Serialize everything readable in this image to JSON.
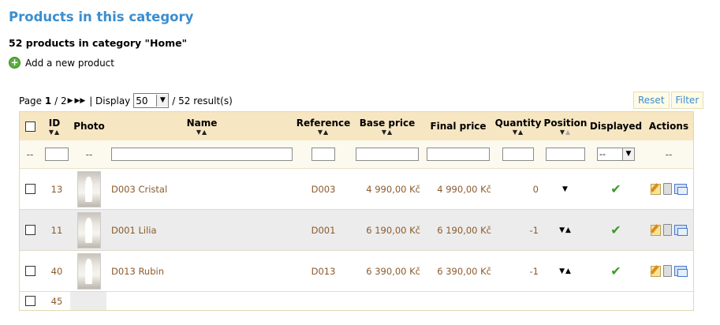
{
  "page": {
    "title": "Products in this category",
    "count_text": "52 products in category \"Home\"",
    "add_label": "Add a new product"
  },
  "pager": {
    "page_label": "Page",
    "current_page": "1",
    "sep": "/",
    "total_pages": "2",
    "display_label": "| Display",
    "per_page": "50",
    "results": "/ 52 result(s)"
  },
  "buttons": {
    "reset": "Reset",
    "filter": "Filter"
  },
  "columns": {
    "id": "ID",
    "photo": "Photo",
    "name": "Name",
    "reference": "Reference",
    "base_price": "Base price",
    "final_price": "Final price",
    "quantity": "Quantity",
    "position": "Position",
    "displayed": "Displayed",
    "actions": "Actions"
  },
  "filters": {
    "dash": "--",
    "displayed_value": "--"
  },
  "rows": [
    {
      "id": "13",
      "name": "D003 Cristal",
      "reference": "D003",
      "base_price": "4 990,00 Kč",
      "final_price": "4 990,00 Kč",
      "quantity": "0",
      "position": "▼"
    },
    {
      "id": "11",
      "name": "D001 Lilia",
      "reference": "D001",
      "base_price": "6 190,00 Kč",
      "final_price": "6 190,00 Kč",
      "quantity": "-1",
      "position": "▼▲"
    },
    {
      "id": "40",
      "name": "D013 Rubin",
      "reference": "D013",
      "base_price": "6 390,00 Kč",
      "final_price": "6 390,00 Kč",
      "quantity": "-1",
      "position": "▼▲"
    },
    {
      "id": "45"
    }
  ],
  "colors": {
    "title": "#3a8ecf",
    "header_bg": "#f7e6c2",
    "link": "#8b5a2b",
    "displayed_ok": "#3a9a2a"
  },
  "icons": [
    "add-icon",
    "next-page-icon",
    "last-page-icon",
    "chevron-down-icon",
    "sort-arrows-icon",
    "check-icon",
    "edit-icon",
    "delete-icon",
    "duplicate-icon"
  ]
}
